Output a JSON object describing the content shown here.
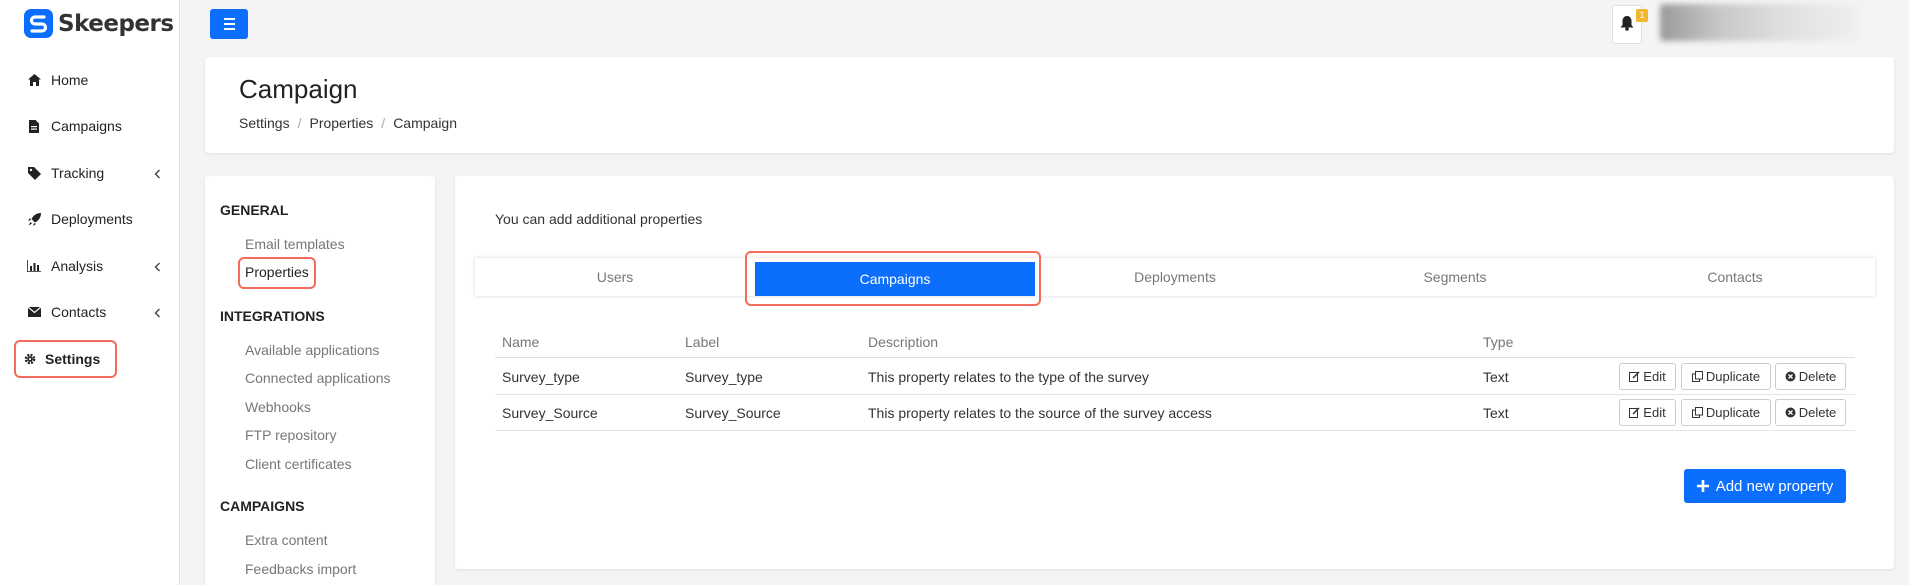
{
  "brand": {
    "name": "Skeepers",
    "accent": "#0b6efd",
    "highlight": "#f26b5b"
  },
  "sidebar": {
    "items": [
      {
        "label": "Home",
        "icon": "home-icon"
      },
      {
        "label": "Campaigns",
        "icon": "file-icon"
      },
      {
        "label": "Tracking",
        "icon": "tag-icon"
      },
      {
        "label": "Deployments",
        "icon": "rocket-icon"
      },
      {
        "label": "Analysis",
        "icon": "bar-chart-icon"
      },
      {
        "label": "Contacts",
        "icon": "envelope-icon"
      },
      {
        "label": "Settings",
        "icon": "gear-icon"
      }
    ]
  },
  "topbar": {
    "notification_count": "1"
  },
  "header": {
    "title": "Campaign",
    "breadcrumb": [
      "Settings",
      "Properties",
      "Campaign"
    ]
  },
  "settings_menu": {
    "general": {
      "heading": "GENERAL",
      "items": [
        "Email templates",
        "Properties"
      ]
    },
    "integrations": {
      "heading": "INTEGRATIONS",
      "items": [
        "Available applications",
        "Connected applications",
        "Webhooks",
        "FTP repository",
        "Client certificates"
      ]
    },
    "campaigns": {
      "heading": "CAMPAIGNS",
      "items": [
        "Extra content",
        "Feedbacks import"
      ]
    }
  },
  "main": {
    "intro": "You can add additional properties",
    "tabs": [
      "Users",
      "Campaigns",
      "Deployments",
      "Segments",
      "Contacts"
    ],
    "table": {
      "headers": [
        "Name",
        "Label",
        "Description",
        "Type"
      ],
      "rows": [
        {
          "name": "Survey_type",
          "label": "Survey_type",
          "description": "This property relates to the type of the survey",
          "type": "Text"
        },
        {
          "name": "Survey_Source",
          "label": "Survey_Source",
          "description": "This property relates to the source of the survey access",
          "type": "Text"
        }
      ],
      "actions": {
        "edit": "Edit",
        "duplicate": "Duplicate",
        "delete": "Delete"
      }
    },
    "add_button": "Add new property"
  }
}
